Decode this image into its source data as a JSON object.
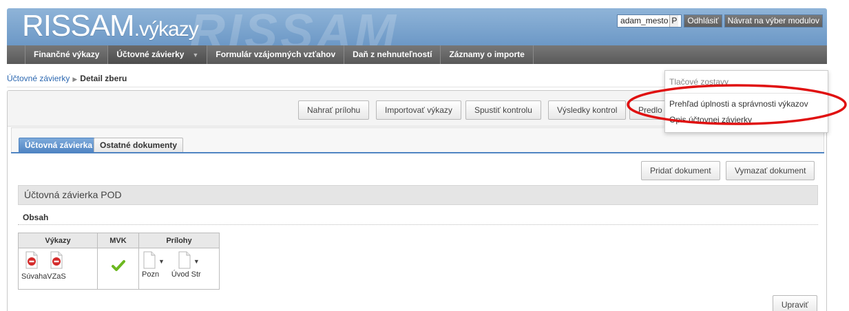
{
  "header": {
    "logo_main": "RISSAM",
    "logo_sub": ".výkazy",
    "watermark": "RISSAM",
    "username": "adam_mesto",
    "username_suffix": "P",
    "logout_label": "Odhlásiť",
    "back_label": "Návrat na výber modulov"
  },
  "nav": {
    "items": [
      "Finančné výkazy",
      "Účtovné závierky",
      "Formulár vzájomných vzťahov",
      "Daň z nehnuteľností",
      "Záznamy o importe"
    ]
  },
  "breadcrumb": {
    "link": "Účtovné závierky",
    "current": "Detail zberu"
  },
  "toolbar": {
    "upload_label": "Nahrať prílohu",
    "import_label": "Importovať výkazy",
    "run_check_label": "Spustiť kontrolu",
    "results_label": "Výsledky kontrol",
    "submit_label_partial": "Predlo"
  },
  "dropdown": {
    "header": "Tlačové zostavy",
    "items": [
      "Prehľad úplnosti a správnosti výkazov",
      "Opis účtovnej závierky"
    ]
  },
  "tabs": [
    "Účtovná závierka",
    "Ostatné dokumenty"
  ],
  "actions": {
    "add_doc_label": "Pridať dokument",
    "delete_doc_label": "Vymazať dokument",
    "edit_label": "Upraviť"
  },
  "section": {
    "title": "Účtovná závierka POD",
    "content_label": "Obsah"
  },
  "report_table": {
    "headers": [
      "Výkazy",
      "MVK",
      "Prílohy"
    ],
    "reports": [
      "Súvaha",
      "VZaS"
    ],
    "attachments": [
      "Pozn",
      "Úvod Str"
    ]
  },
  "colors": {
    "header_blue": "#7aa4d0",
    "nav_gray": "#666666",
    "tab_active": "#4f84c2",
    "annotation_red": "#e01010",
    "ok_green": "#6cb820",
    "error_red": "#d42b2b"
  }
}
